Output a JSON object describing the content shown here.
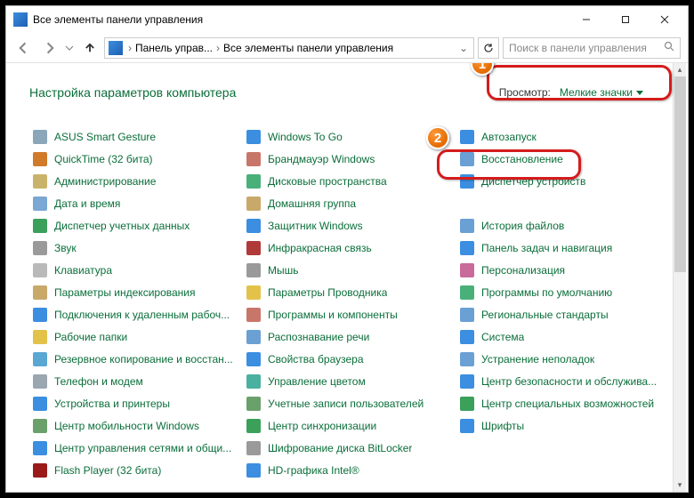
{
  "window": {
    "title": "Все элементы панели управления"
  },
  "address": {
    "crumb1": "Панель управ...",
    "crumb2": "Все элементы панели управления",
    "search_placeholder": "Поиск в панели управления"
  },
  "header": {
    "title": "Настройка параметров компьютера",
    "view_label": "Просмотр:",
    "view_value": "Мелкие значки"
  },
  "callouts": {
    "one": "1",
    "two": "2"
  },
  "items": [
    {
      "label": "ASUS Smart Gesture",
      "color": "#8aa6b8"
    },
    {
      "label": "QuickTime (32 бита)",
      "color": "#d07a2a"
    },
    {
      "label": "Администрирование",
      "color": "#c9b36a"
    },
    {
      "label": "Дата и время",
      "color": "#7aa7d4"
    },
    {
      "label": "Диспетчер учетных данных",
      "color": "#3aa05a"
    },
    {
      "label": "Звук",
      "color": "#9a9a9a"
    },
    {
      "label": "Клавиатура",
      "color": "#b9b9b9"
    },
    {
      "label": "Параметры индексирования",
      "color": "#c9a96a"
    },
    {
      "label": "Подключения к удаленным рабоч...",
      "color": "#3b8ee0"
    },
    {
      "label": "Рабочие папки",
      "color": "#e3c24a"
    },
    {
      "label": "Резервное копирование и восстан...",
      "color": "#5aa7d4"
    },
    {
      "label": "Телефон и модем",
      "color": "#9aa6b0"
    },
    {
      "label": "Устройства и принтеры",
      "color": "#3b8ee0"
    },
    {
      "label": "Центр мобильности Windows",
      "color": "#6aa06a"
    },
    {
      "label": "Центр управления сетями и общи...",
      "color": "#3b8ee0"
    },
    {
      "label": "Flash Player (32 бита)",
      "color": "#9a1a1a"
    },
    {
      "label": "Windows To Go",
      "color": "#3b8ee0"
    },
    {
      "label": "Брандмауэр Windows",
      "color": "#c9766a"
    },
    {
      "label": "Дисковые пространства",
      "color": "#4ab07a"
    },
    {
      "label": "Домашняя группа",
      "color": "#c9a96a"
    },
    {
      "label": "Защитник Windows",
      "color": "#3b8ee0"
    },
    {
      "label": "Инфракрасная связь",
      "color": "#b03a3a"
    },
    {
      "label": "Мышь",
      "color": "#9a9a9a"
    },
    {
      "label": "Параметры Проводника",
      "color": "#e3c24a"
    },
    {
      "label": "Программы и компоненты",
      "color": "#c9766a"
    },
    {
      "label": "Распознавание речи",
      "color": "#6aa0d4"
    },
    {
      "label": "Свойства браузера",
      "color": "#3b8ee0"
    },
    {
      "label": "Управление цветом",
      "color": "#4ab0a0"
    },
    {
      "label": "Учетные записи пользователей",
      "color": "#6aa06a"
    },
    {
      "label": "Центр синхронизации",
      "color": "#3aa05a"
    },
    {
      "label": "Шифрование диска BitLocker",
      "color": "#9a9a9a"
    },
    {
      "label": "HD-графика Intel®",
      "color": "#3b8ee0"
    },
    {
      "label": "Автозапуск",
      "color": "#3b8ee0"
    },
    {
      "label": "Восстановление",
      "color": "#6aa0d4"
    },
    {
      "label": "Диспетчер устройств",
      "color": "#3b8ee0"
    },
    {
      "label": "Домашняя группа",
      "color": "#c9a96a",
      "hidden": true
    },
    {
      "label": "История файлов",
      "color": "#6aa0d4"
    },
    {
      "label": "Панель задач и навигация",
      "color": "#3b8ee0"
    },
    {
      "label": "Персонализация",
      "color": "#c96a9a"
    },
    {
      "label": "Программы по умолчанию",
      "color": "#4ab07a"
    },
    {
      "label": "Региональные стандарты",
      "color": "#6aa0d4"
    },
    {
      "label": "Система",
      "color": "#3b8ee0"
    },
    {
      "label": "Устранение неполадок",
      "color": "#6aa0d4"
    },
    {
      "label": "Центр безопасности и обслужива...",
      "color": "#3b8ee0"
    },
    {
      "label": "Центр специальных возможностей",
      "color": "#3aa05a"
    },
    {
      "label": "Шрифты",
      "color": "#3b8ee0"
    }
  ]
}
